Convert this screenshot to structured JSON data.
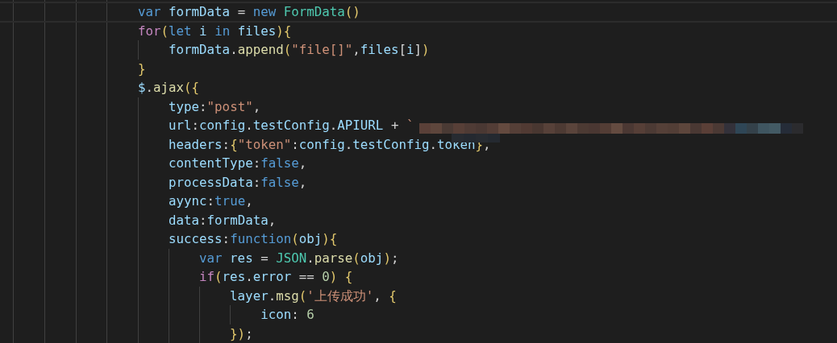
{
  "lines": [
    {
      "current": true,
      "tokens": [
        {
          "kind": "kw",
          "text": "var "
        },
        {
          "kind": "v",
          "text": "formData"
        },
        {
          "kind": "p",
          "text": " = "
        },
        {
          "kind": "kw",
          "text": "new "
        },
        {
          "kind": "cls",
          "text": "FormData"
        },
        {
          "kind": "br",
          "text": "()"
        }
      ]
    },
    {
      "current": false,
      "tokens": [
        {
          "kind": "ctl",
          "text": "for"
        },
        {
          "kind": "br",
          "text": "("
        },
        {
          "kind": "kw",
          "text": "let "
        },
        {
          "kind": "v",
          "text": "i "
        },
        {
          "kind": "kw",
          "text": "in "
        },
        {
          "kind": "v",
          "text": "files"
        },
        {
          "kind": "br",
          "text": "){"
        }
      ],
      "children": [
        {
          "current": false,
          "tokens": [
            {
              "kind": "v",
              "text": "formData"
            },
            {
              "kind": "p",
              "text": "."
            },
            {
              "kind": "fn",
              "text": "append"
            },
            {
              "kind": "br",
              "text": "("
            },
            {
              "kind": "s",
              "text": "\"file[]\""
            },
            {
              "kind": "p",
              "text": ","
            },
            {
              "kind": "v",
              "text": "files"
            },
            {
              "kind": "p",
              "text": "["
            },
            {
              "kind": "v",
              "text": "i"
            },
            {
              "kind": "p",
              "text": "]"
            },
            {
              "kind": "br",
              "text": ")"
            }
          ]
        }
      ]
    },
    {
      "current": false,
      "tokens": [
        {
          "kind": "br",
          "text": "}"
        }
      ]
    },
    {
      "current": false,
      "tokens": [
        {
          "kind": "v",
          "text": "$"
        },
        {
          "kind": "p",
          "text": "."
        },
        {
          "kind": "fn",
          "text": "ajax"
        },
        {
          "kind": "br",
          "text": "({"
        }
      ],
      "children": [
        {
          "current": false,
          "tokens": [
            {
              "kind": "v",
              "text": "type"
            },
            {
              "kind": "p",
              "text": ":"
            },
            {
              "kind": "s",
              "text": "\"post\""
            },
            {
              "kind": "p",
              "text": ","
            }
          ]
        },
        {
          "current": false,
          "tokens": [
            {
              "kind": "v",
              "text": "url"
            },
            {
              "kind": "p",
              "text": ":"
            },
            {
              "kind": "v",
              "text": "config"
            },
            {
              "kind": "p",
              "text": "."
            },
            {
              "kind": "v",
              "text": "testConfig"
            },
            {
              "kind": "p",
              "text": "."
            },
            {
              "kind": "v",
              "text": "APIURL"
            },
            {
              "kind": "p",
              "text": " + "
            },
            {
              "kind": "s",
              "text": "`"
            }
          ]
        },
        {
          "current": false,
          "tokens": [
            {
              "kind": "v",
              "text": "headers"
            },
            {
              "kind": "p",
              "text": ":"
            },
            {
              "kind": "br",
              "text": "{"
            },
            {
              "kind": "s",
              "text": "\"token\""
            },
            {
              "kind": "p",
              "text": ":"
            },
            {
              "kind": "v",
              "text": "config"
            },
            {
              "kind": "p",
              "text": "."
            },
            {
              "kind": "v",
              "text": "testConfig"
            },
            {
              "kind": "p",
              "text": "."
            },
            {
              "kind": "v",
              "text": "token"
            },
            {
              "kind": "br",
              "text": "}"
            },
            {
              "kind": "p",
              "text": ","
            }
          ]
        },
        {
          "current": false,
          "tokens": [
            {
              "kind": "v",
              "text": "contentType"
            },
            {
              "kind": "p",
              "text": ":"
            },
            {
              "kind": "kw",
              "text": "false"
            },
            {
              "kind": "p",
              "text": ","
            }
          ]
        },
        {
          "current": false,
          "tokens": [
            {
              "kind": "v",
              "text": "processData"
            },
            {
              "kind": "p",
              "text": ":"
            },
            {
              "kind": "kw",
              "text": "false"
            },
            {
              "kind": "p",
              "text": ","
            }
          ]
        },
        {
          "current": false,
          "tokens": [
            {
              "kind": "v",
              "text": "ayync"
            },
            {
              "kind": "p",
              "text": ":"
            },
            {
              "kind": "kw",
              "text": "true"
            },
            {
              "kind": "p",
              "text": ","
            }
          ]
        },
        {
          "current": false,
          "tokens": [
            {
              "kind": "v",
              "text": "data"
            },
            {
              "kind": "p",
              "text": ":"
            },
            {
              "kind": "v",
              "text": "formData"
            },
            {
              "kind": "p",
              "text": ","
            }
          ]
        },
        {
          "current": false,
          "tokens": [
            {
              "kind": "v",
              "text": "success"
            },
            {
              "kind": "p",
              "text": ":"
            },
            {
              "kind": "kw",
              "text": "function"
            },
            {
              "kind": "br",
              "text": "("
            },
            {
              "kind": "v",
              "text": "obj"
            },
            {
              "kind": "br",
              "text": "){"
            }
          ],
          "children": [
            {
              "current": false,
              "tokens": [
                {
                  "kind": "kw",
                  "text": "var "
                },
                {
                  "kind": "v",
                  "text": "res"
                },
                {
                  "kind": "p",
                  "text": " = "
                },
                {
                  "kind": "cls",
                  "text": "JSON"
                },
                {
                  "kind": "p",
                  "text": "."
                },
                {
                  "kind": "fn",
                  "text": "parse"
                },
                {
                  "kind": "br",
                  "text": "("
                },
                {
                  "kind": "v",
                  "text": "obj"
                },
                {
                  "kind": "br",
                  "text": ")"
                },
                {
                  "kind": "p",
                  "text": ";"
                }
              ]
            },
            {
              "current": false,
              "tokens": [
                {
                  "kind": "ctl",
                  "text": "if"
                },
                {
                  "kind": "br",
                  "text": "("
                },
                {
                  "kind": "v",
                  "text": "res"
                },
                {
                  "kind": "p",
                  "text": "."
                },
                {
                  "kind": "v",
                  "text": "error"
                },
                {
                  "kind": "p",
                  "text": " == "
                },
                {
                  "kind": "n",
                  "text": "0"
                },
                {
                  "kind": "br",
                  "text": ")"
                },
                {
                  "kind": "br",
                  "text": " {"
                }
              ],
              "children": [
                {
                  "current": false,
                  "tokens": [
                    {
                      "kind": "v",
                      "text": "layer"
                    },
                    {
                      "kind": "p",
                      "text": "."
                    },
                    {
                      "kind": "fn",
                      "text": "msg"
                    },
                    {
                      "kind": "br",
                      "text": "("
                    },
                    {
                      "kind": "s",
                      "text": "'上传成功'"
                    },
                    {
                      "kind": "p",
                      "text": ", "
                    },
                    {
                      "kind": "br",
                      "text": "{"
                    }
                  ],
                  "children": [
                    {
                      "current": false,
                      "tokens": [
                        {
                          "kind": "v",
                          "text": "icon"
                        },
                        {
                          "kind": "p",
                          "text": ": "
                        },
                        {
                          "kind": "n",
                          "text": "6"
                        }
                      ]
                    }
                  ]
                },
                {
                  "current": false,
                  "tokens": [
                    {
                      "kind": "br",
                      "text": "})"
                    },
                    {
                      "kind": "p",
                      "text": ";"
                    }
                  ]
                }
              ]
            }
          ]
        }
      ]
    }
  ]
}
